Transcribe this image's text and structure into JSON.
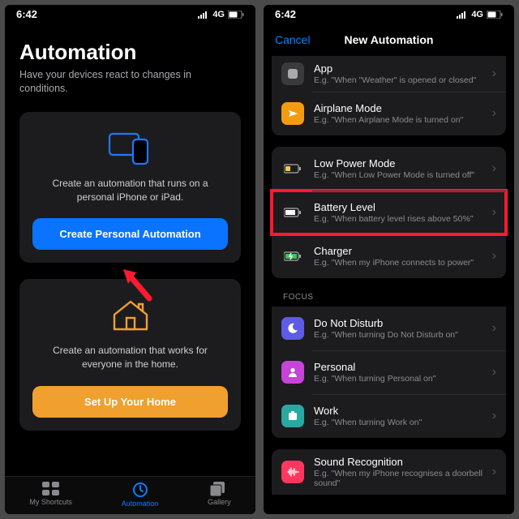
{
  "status": {
    "time": "6:42",
    "network": "4G"
  },
  "left": {
    "title": "Automation",
    "subtitle": "Have your devices react to changes in conditions.",
    "card1": {
      "text": "Create an automation that runs on a personal iPhone or iPad.",
      "button": "Create Personal Automation"
    },
    "card2": {
      "text": "Create an automation that works for everyone in the home.",
      "button": "Set Up Your Home"
    },
    "tabs": {
      "shortcuts": "My Shortcuts",
      "automation": "Automation",
      "gallery": "Gallery"
    }
  },
  "right": {
    "cancel": "Cancel",
    "title": "New Automation",
    "rows": {
      "app": {
        "title": "App",
        "sub": "E.g. \"When \"Weather\" is opened or closed\""
      },
      "airplane": {
        "title": "Airplane Mode",
        "sub": "E.g. \"When Airplane Mode is turned on\""
      },
      "lowpower": {
        "title": "Low Power Mode",
        "sub": "E.g. \"When Low Power Mode is turned off\""
      },
      "battery": {
        "title": "Battery Level",
        "sub": "E.g. \"When battery level rises above 50%\""
      },
      "charger": {
        "title": "Charger",
        "sub": "E.g. \"When my iPhone connects to power\""
      },
      "dnd": {
        "title": "Do Not Disturb",
        "sub": "E.g. \"When turning Do Not Disturb on\""
      },
      "personal": {
        "title": "Personal",
        "sub": "E.g. \"When turning Personal on\""
      },
      "work": {
        "title": "Work",
        "sub": "E.g. \"When turning Work on\""
      },
      "sound": {
        "title": "Sound Recognition",
        "sub": "E.g. \"When my iPhone recognises a doorbell sound\""
      }
    },
    "focusHeader": "FOCUS"
  }
}
